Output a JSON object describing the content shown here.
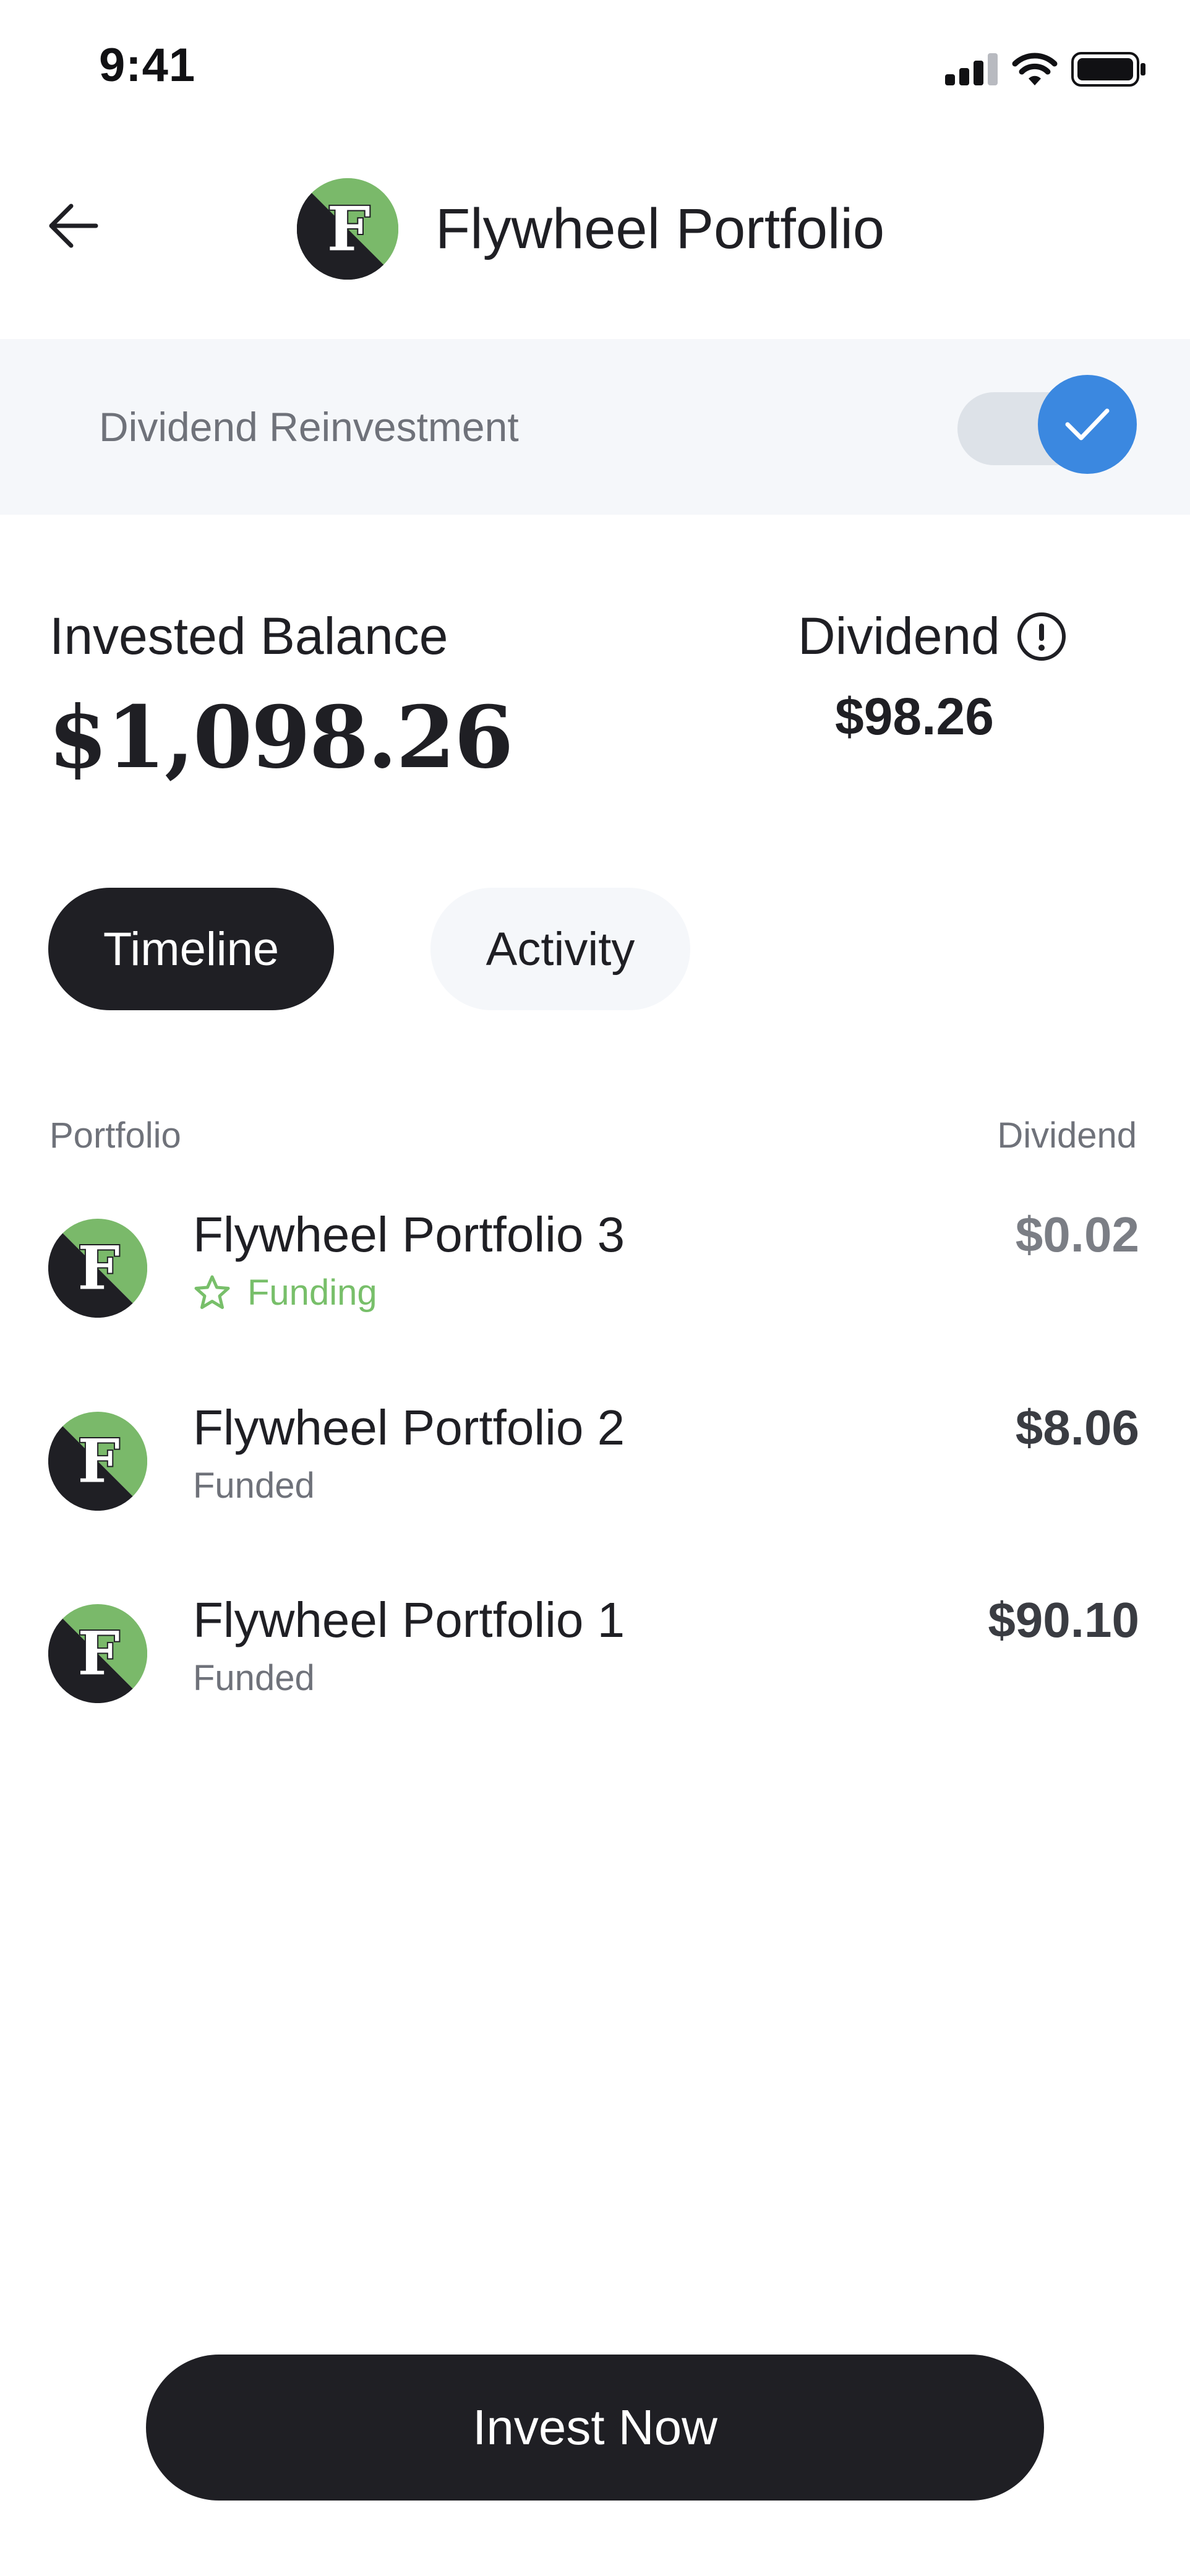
{
  "status_bar": {
    "time": "9:41",
    "icons": [
      "cellular-signal-icon",
      "wifi-icon",
      "battery-icon"
    ]
  },
  "header": {
    "title": "Flywheel Portfolio",
    "back_icon": "arrow-left-icon",
    "logo_letter": "F"
  },
  "reinvestment": {
    "label": "Dividend Reinvestment",
    "enabled": true
  },
  "balance": {
    "invested_label": "Invested Balance",
    "invested_value": "$1,098.26",
    "dividend_label": "Dividend",
    "dividend_value": "$98.26",
    "info_icon": "info-circle-icon"
  },
  "tabs": [
    {
      "label": "Timeline",
      "active": true
    },
    {
      "label": "Activity",
      "active": false
    }
  ],
  "table": {
    "columns": [
      "Portfolio",
      "Dividend"
    ],
    "rows": [
      {
        "name": "Flywheel Portfolio 3",
        "status": "Funding",
        "status_icon": "star-icon",
        "amount": "$0.02"
      },
      {
        "name": "Flywheel Portfolio 2",
        "status": "Funded",
        "amount": "$8.06"
      },
      {
        "name": "Flywheel Portfolio 1",
        "status": "Funded",
        "amount": "$90.10"
      }
    ]
  },
  "cta": {
    "label": "Invest Now"
  },
  "colors": {
    "brand_dark": "#1f1f24",
    "brand_green": "#7ab96a",
    "accent_blue": "#3b88e0",
    "band_bg": "#f5f7fa",
    "muted_text": "#6f727a",
    "funding_green": "#78bf6a"
  }
}
